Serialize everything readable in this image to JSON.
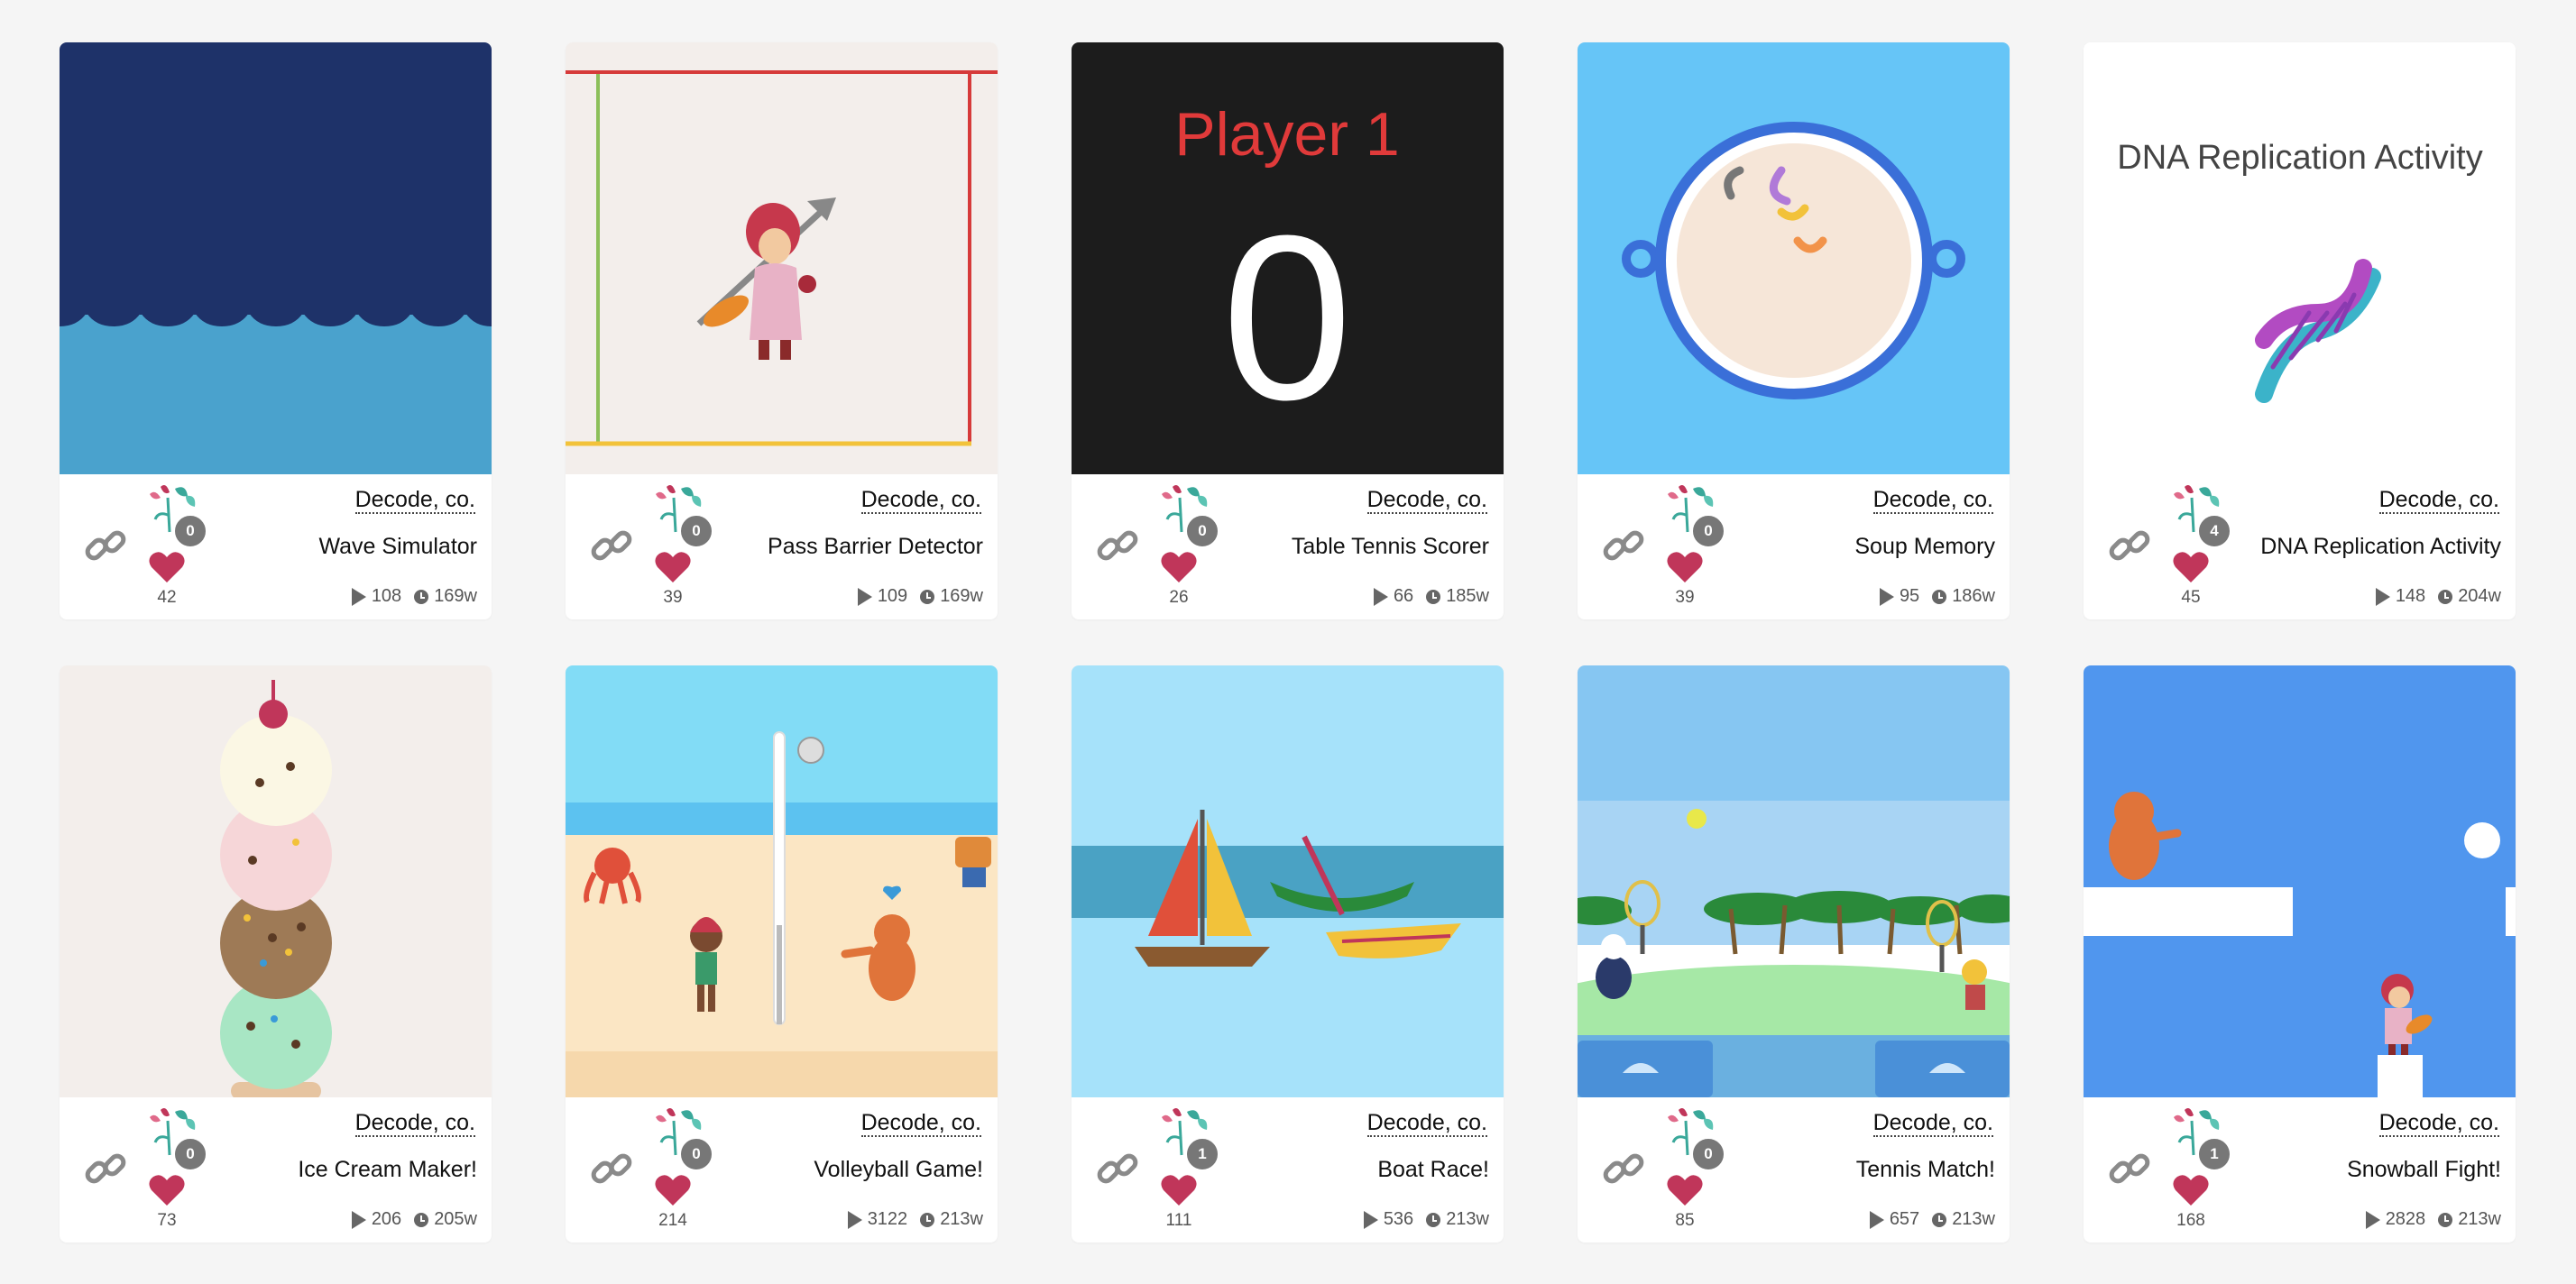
{
  "cards": [
    {
      "title": "Wave Simulator",
      "author": "Decode, co.",
      "remixes": "0",
      "likes": "42",
      "plays": "108",
      "age": "169w",
      "thumb_icon": "waves-thumbnail"
    },
    {
      "title": "Pass Barrier Detector",
      "author": "Decode, co.",
      "remixes": "0",
      "likes": "39",
      "plays": "109",
      "age": "169w",
      "thumb_icon": "girl-with-arrow-thumbnail"
    },
    {
      "title": "Table Tennis Scorer",
      "author": "Decode, co.",
      "remixes": "0",
      "likes": "26",
      "plays": "66",
      "age": "185w",
      "thumb_icon": "scoreboard-thumbnail",
      "thumb_text_1": "Player 1",
      "thumb_text_2": "0"
    },
    {
      "title": "Soup Memory",
      "author": "Decode, co.",
      "remixes": "0",
      "likes": "39",
      "plays": "95",
      "age": "186w",
      "thumb_icon": "soup-bowl-thumbnail"
    },
    {
      "title": "DNA Replication Activity",
      "author": "Decode, co.",
      "remixes": "4",
      "likes": "45",
      "plays": "148",
      "age": "204w",
      "thumb_icon": "dna-thumbnail",
      "thumb_text_1": "DNA Replication Activity"
    },
    {
      "title": "Ice Cream Maker!",
      "author": "Decode, co.",
      "remixes": "0",
      "likes": "73",
      "plays": "206",
      "age": "205w",
      "thumb_icon": "ice-cream-stack-thumbnail"
    },
    {
      "title": "Volleyball Game!",
      "author": "Decode, co.",
      "remixes": "0",
      "likes": "214",
      "plays": "3122",
      "age": "213w",
      "thumb_icon": "beach-volleyball-thumbnail"
    },
    {
      "title": "Boat Race!",
      "author": "Decode, co.",
      "remixes": "1",
      "likes": "111",
      "plays": "536",
      "age": "213w",
      "thumb_icon": "boats-thumbnail"
    },
    {
      "title": "Tennis Match!",
      "author": "Decode, co.",
      "remixes": "0",
      "likes": "85",
      "plays": "657",
      "age": "213w",
      "thumb_icon": "tennis-court-thumbnail"
    },
    {
      "title": "Snowball Fight!",
      "author": "Decode, co.",
      "remixes": "1",
      "likes": "168",
      "plays": "2828",
      "age": "213w",
      "thumb_icon": "snowball-fight-thumbnail"
    }
  ],
  "colors": {
    "heart": "#c0365a",
    "badge": "#777777",
    "link_icon": "#8a8a8a"
  }
}
